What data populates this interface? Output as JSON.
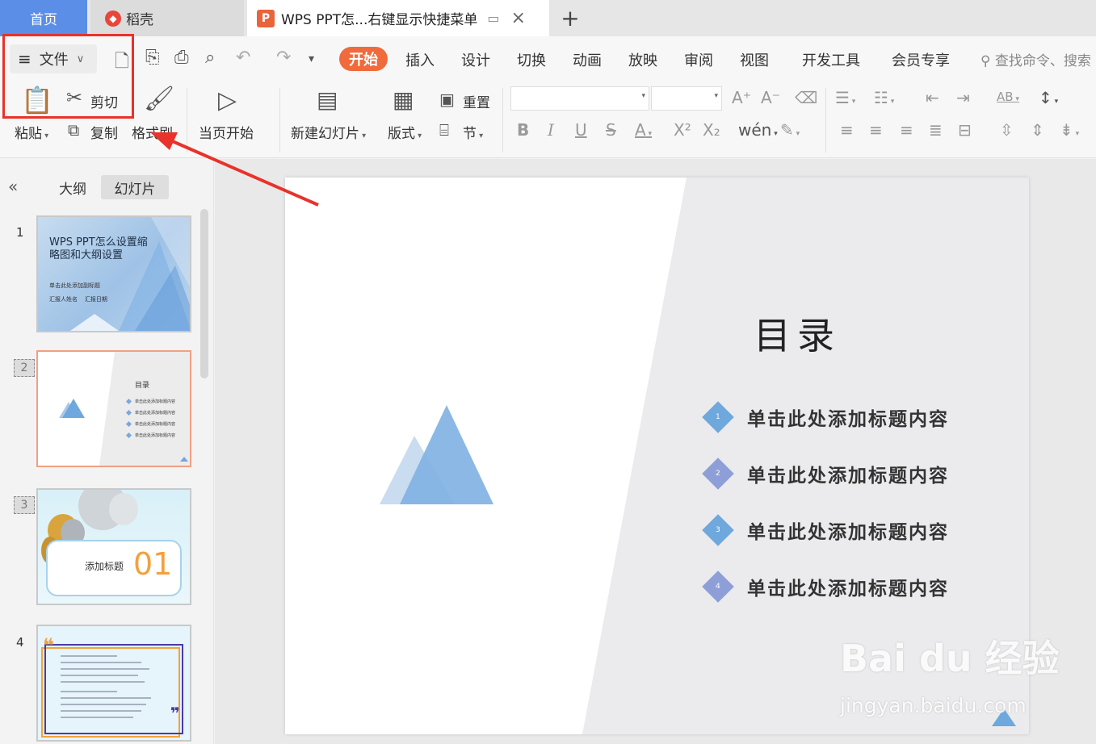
{
  "tabs": {
    "home": "首页",
    "daoke": "稻壳",
    "doc_title": "WPS PPT怎...右键显示快捷菜单",
    "add": "+"
  },
  "menu": {
    "file": "文件",
    "items": [
      "开始",
      "插入",
      "设计",
      "切换",
      "动画",
      "放映",
      "审阅",
      "视图",
      "开发工具",
      "会员专享"
    ],
    "search": "查找命令、搜索"
  },
  "ribbon": {
    "paste": "粘贴",
    "cut": "剪切",
    "copy": "复制",
    "format_painter": "格式刷",
    "from_current": "当页开始",
    "new_slide": "新建幻灯片",
    "layout": "版式",
    "reset": "重置",
    "section": "节"
  },
  "left_panel": {
    "outline_tab": "大纲",
    "slides_tab": "幻灯片",
    "slides": [
      {
        "num": "1",
        "title": "WPS PPT怎么设置缩略图和大纲设置",
        "subtitle": "单击此处添加副标题",
        "reporter": "汇报人姓名",
        "date": "汇报日期"
      },
      {
        "num": "2",
        "title": "目录",
        "items": [
          "单击此处添加标题内容",
          "单击此处添加标题内容",
          "单击此处添加标题内容",
          "单击此处添加标题内容"
        ]
      },
      {
        "num": "3",
        "label": "添加标题",
        "big_num": "01"
      },
      {
        "num": "4"
      }
    ]
  },
  "slide": {
    "title": "目录",
    "items": [
      {
        "num": "1",
        "text": "单击此处添加标题内容",
        "color": "#6fa8dc"
      },
      {
        "num": "2",
        "text": "单击此处添加标题内容",
        "color": "#8e9fd8"
      },
      {
        "num": "3",
        "text": "单击此处添加标题内容",
        "color": "#6fa8dc"
      },
      {
        "num": "4",
        "text": "单击此处添加标题内容",
        "color": "#8e9fd8"
      }
    ]
  },
  "watermark": {
    "brand": "Bai du 经验",
    "url": "jingyan.baidu.com"
  },
  "colors": {
    "accent": "#f06a3c",
    "home_tab": "#5b8ee6",
    "annotation": "#e8322a"
  }
}
